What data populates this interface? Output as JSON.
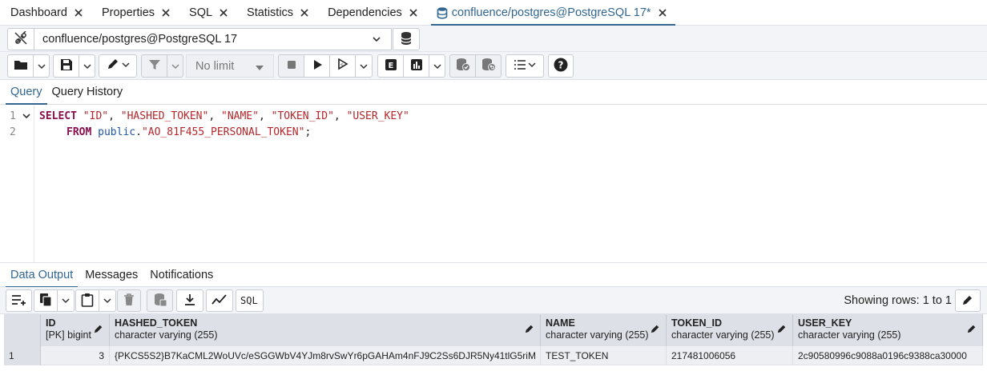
{
  "tabs": [
    {
      "label": "Dashboard"
    },
    {
      "label": "Properties"
    },
    {
      "label": "SQL"
    },
    {
      "label": "Statistics"
    },
    {
      "label": "Dependencies"
    },
    {
      "label": "confluence/postgres@PostgreSQL 17*"
    }
  ],
  "connection": {
    "value": "confluence/postgres@PostgreSQL 17"
  },
  "toolbar": {
    "limit_value": "No limit"
  },
  "query_tabs": [
    {
      "label": "Query"
    },
    {
      "label": "Query History"
    }
  ],
  "editor": {
    "line_numbers": [
      "1",
      "2"
    ],
    "line1": {
      "kw": "SELECT",
      "c1": "\"ID\"",
      "s1": ", ",
      "c2": "\"HASHED_TOKEN\"",
      "s2": ", ",
      "c3": "\"NAME\"",
      "s3": ", ",
      "c4": "\"TOKEN_ID\"",
      "s4": ", ",
      "c5": "\"USER_KEY\""
    },
    "line2": {
      "kw": "FROM",
      "schema": "public",
      "dot": ".",
      "table": "\"AO_81F455_PERSONAL_TOKEN\"",
      "end": ";"
    }
  },
  "result_tabs": [
    {
      "label": "Data Output"
    },
    {
      "label": "Messages"
    },
    {
      "label": "Notifications"
    }
  ],
  "results": {
    "showing_rows": "Showing rows: 1 to 1",
    "columns": [
      {
        "name": "ID",
        "type": "[PK] bigint"
      },
      {
        "name": "HASHED_TOKEN",
        "type": "character varying (255)"
      },
      {
        "name": "NAME",
        "type": "character varying (255)"
      },
      {
        "name": "TOKEN_ID",
        "type": "character varying (255)"
      },
      {
        "name": "USER_KEY",
        "type": "character varying (255)"
      }
    ],
    "rows": [
      {
        "row_number": "1",
        "cells": [
          "3",
          "{PKCS5S2}B7KaCML2WoUVc/eSGGWbV4YJm8rvSwYr6pGAHAm4nFJ9C2Ss6DJR5Ny41tlG5riM",
          "TEST_TOKEN",
          "217481006056",
          "2c90580996c9088a0196c9388ca30000"
        ]
      }
    ]
  },
  "colors": {
    "accent": "#326690",
    "header_bg": "#dde0e6",
    "toolbar_bg": "#f3f4f7"
  }
}
